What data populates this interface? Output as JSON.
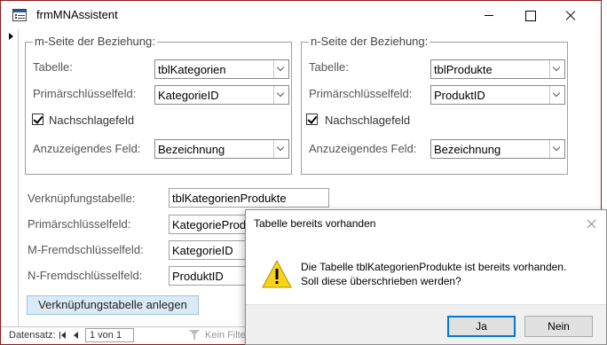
{
  "window": {
    "title": "frmMNAssistent"
  },
  "m_side": {
    "title": "m-Seite der Beziehung:",
    "table_label": "Tabelle:",
    "table_value": "tblKategorien",
    "pk_label": "Primärschlüsselfeld:",
    "pk_value": "KategorieID",
    "lookup_label": "Nachschlagefeld",
    "lookup_checked": true,
    "display_label": "Anzuzeigendes Feld:",
    "display_value": "Bezeichnung"
  },
  "n_side": {
    "title": "n-Seite der Beziehung:",
    "table_label": "Tabelle:",
    "table_value": "tblProdukte",
    "pk_label": "Primärschlüsselfeld:",
    "pk_value": "ProduktID",
    "lookup_label": "Nachschlagefeld",
    "lookup_checked": true,
    "display_label": "Anzuzeigendes Feld:",
    "display_value": "Bezeichnung"
  },
  "link": {
    "table_label": "Verknüpfungstabelle:",
    "table_value": "tblKategorienProdukte",
    "pk_label": "Primärschlüsselfeld:",
    "pk_value": "KategorieProduktID",
    "m_fk_label": "M-Fremdschlüsselfeld:",
    "m_fk_value": "KategorieID",
    "n_fk_label": "N-Fremdschlüsselfeld:",
    "n_fk_value": "ProduktID",
    "create_button": "Verknüpfungstabelle anlegen"
  },
  "navbar": {
    "label": "Datensatz:",
    "position": "1 von 1",
    "filter_text": "Kein Filter"
  },
  "dialog": {
    "title": "Tabelle bereits vorhanden",
    "message": "Die Tabelle tblKategorienProdukte ist bereits vorhanden. Soll diese überschrieben werden?",
    "yes_label": "Ja",
    "no_label": "Nein",
    "icon": "warning-icon"
  }
}
